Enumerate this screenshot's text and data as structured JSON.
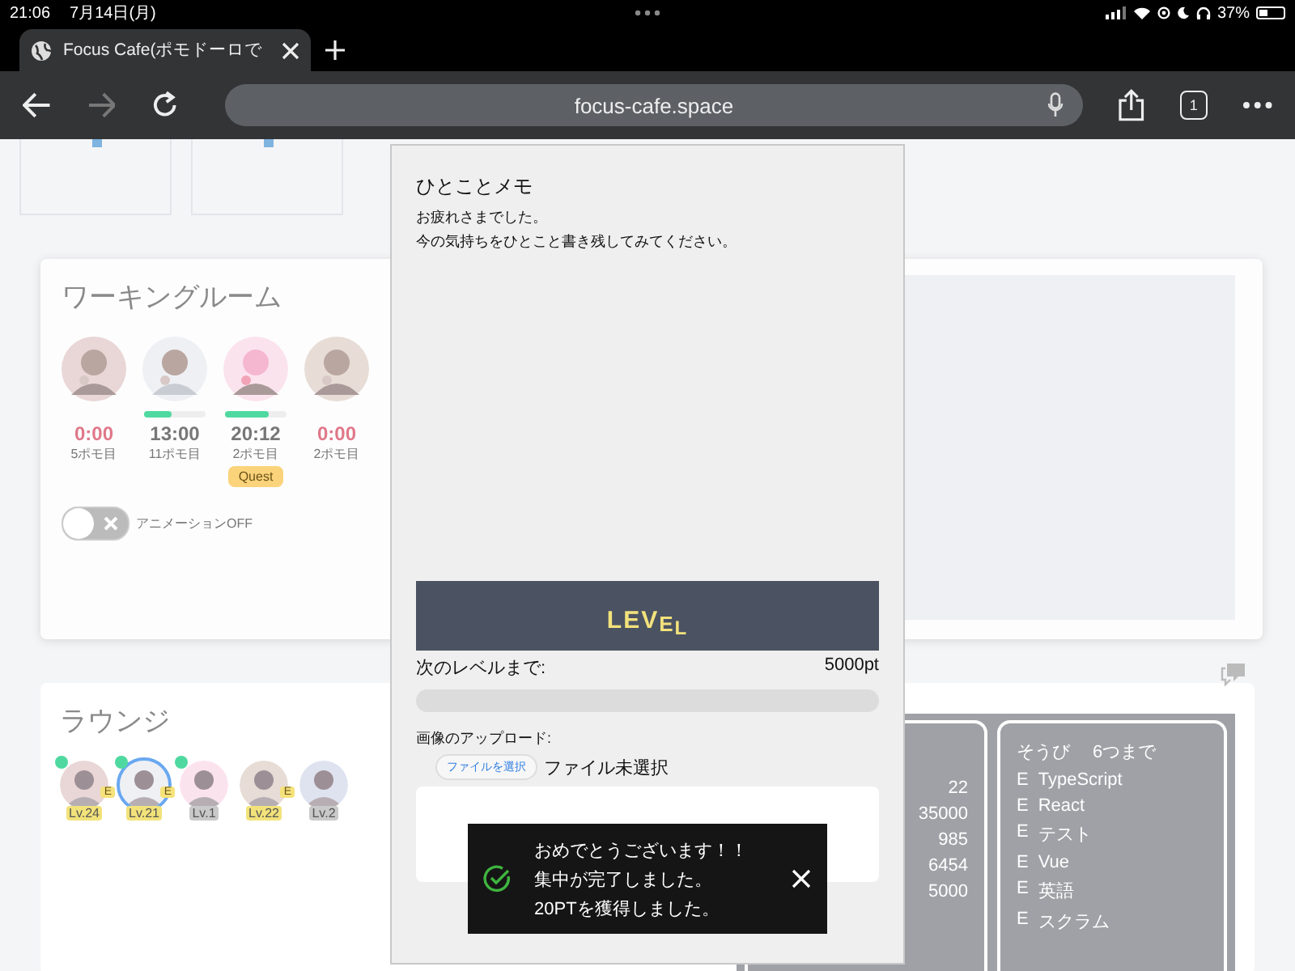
{
  "status_bar": {
    "time": "21:06",
    "date": "7月14日(月)",
    "battery": "37%"
  },
  "browser": {
    "tabs": [
      {
        "title": "Focus Cafe(ポモドーロで",
        "selected": true
      }
    ],
    "url": "focus-cafe.space",
    "tab_count": "1"
  },
  "working_room": {
    "title": "ワーキングルーム",
    "members": [
      {
        "time": "0:00",
        "count": "5ポモ目",
        "active": false
      },
      {
        "time": "13:00",
        "count": "11ポモ目",
        "active": true,
        "level": 0.45
      },
      {
        "time": "20:12",
        "count": "2ポモ目",
        "active": true,
        "level": 0.7,
        "badge": "Quest"
      },
      {
        "time": "0:00",
        "count": "2ポモ目",
        "active": false
      }
    ],
    "animation_toggle": {
      "label": "アニメーションOFF",
      "on": false
    }
  },
  "lounge": {
    "title": "ラウンジ",
    "members": [
      {
        "online": true,
        "badge": "E",
        "level_label": "Lv.24",
        "gold": true,
        "selected": false
      },
      {
        "online": true,
        "badge": "E",
        "level_label": "Lv.21",
        "gold": true,
        "selected": true
      },
      {
        "online": true,
        "level_label": "Lv.1",
        "gold": false,
        "selected": false
      },
      {
        "online": false,
        "badge": "E",
        "level_label": "Lv.22",
        "gold": true,
        "selected": false
      },
      {
        "online": false,
        "level_label": "Lv.2",
        "gold": false,
        "selected": false
      }
    ],
    "stats": [
      "22",
      "35000",
      "985",
      "6454",
      "5000"
    ],
    "equipment": {
      "title": "そうび",
      "limit": "6つまで",
      "items": [
        {
          "mark": "E",
          "name": "TypeScript"
        },
        {
          "mark": "E",
          "name": "React"
        },
        {
          "mark": "E",
          "name": "テスト"
        },
        {
          "mark": "E",
          "name": "Vue"
        },
        {
          "mark": "E",
          "name": "英語"
        },
        {
          "mark": "E",
          "name": "スクラム"
        }
      ]
    }
  },
  "memo_dialog": {
    "title": "ひとことメモ",
    "lines": [
      "お疲れさまでした。",
      "今の気持ちをひとこと書き残してみてください。"
    ],
    "banner": "LEVEL",
    "next_label": "次のレベルまで:",
    "next_value": "5000pt",
    "progress": {
      "level": 0
    },
    "upload_label": "画像のアップロード:",
    "file_button": "ファイルを選択",
    "file_status": "ファイル未選択"
  },
  "toast": {
    "lines": [
      "おめでとうございます！！",
      "集中が完了しました。",
      "20PTを獲得しました。"
    ]
  }
}
